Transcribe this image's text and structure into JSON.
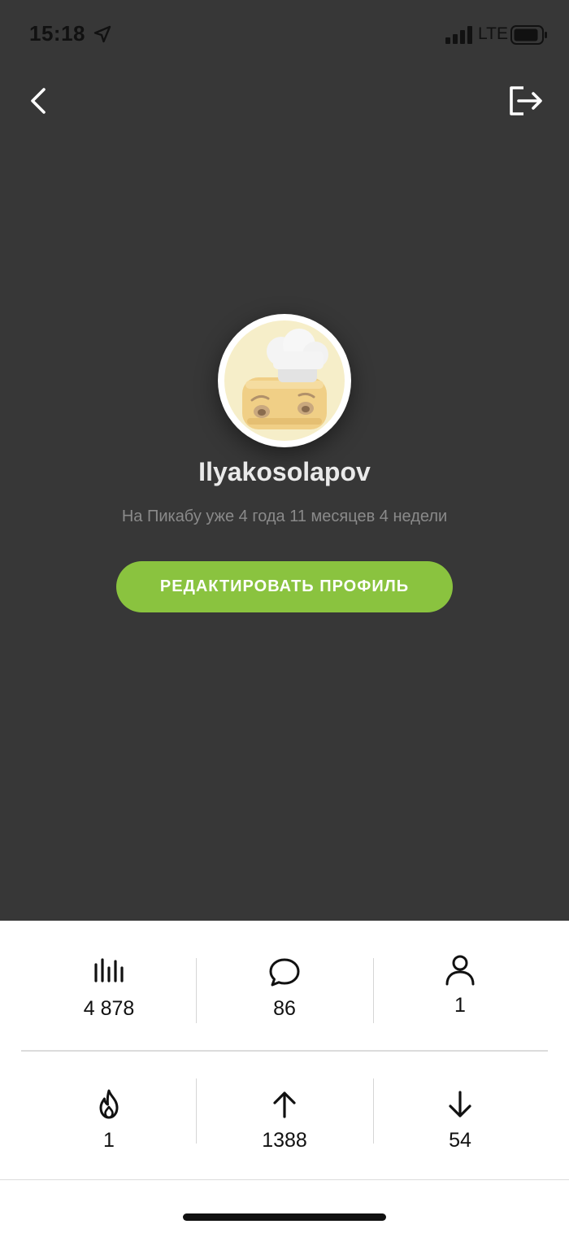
{
  "status_bar": {
    "time": "15:18",
    "network": "LTE",
    "icons": [
      "location-arrow-icon",
      "signal-icon",
      "battery-icon"
    ]
  },
  "nav": {
    "back_icon": "chevron-left-icon",
    "logout_icon": "logout-icon"
  },
  "profile": {
    "avatar": "toaster-chef-avatar",
    "username": "Ilyakosolapov",
    "member_since": "На Пикабу уже 4 года 11 месяцев 4 недели",
    "edit_button_label": "РЕДАКТИРОВАТЬ ПРОФИЛЬ"
  },
  "stats": {
    "rating": {
      "icon": "rating-bars-icon",
      "value": "4 878"
    },
    "comments": {
      "icon": "comment-icon",
      "value": "86"
    },
    "subscribers": {
      "icon": "user-icon",
      "value": "1"
    },
    "hot": {
      "icon": "flame-icon",
      "value": "1"
    },
    "pluses": {
      "icon": "arrow-up-icon",
      "value": "1388"
    },
    "minuses": {
      "icon": "arrow-down-icon",
      "value": "54"
    }
  },
  "colors": {
    "header_bg": "#373737",
    "accent_green": "#8ac33f",
    "text_dark": "#111111",
    "text_muted": "#8a8a8a"
  }
}
